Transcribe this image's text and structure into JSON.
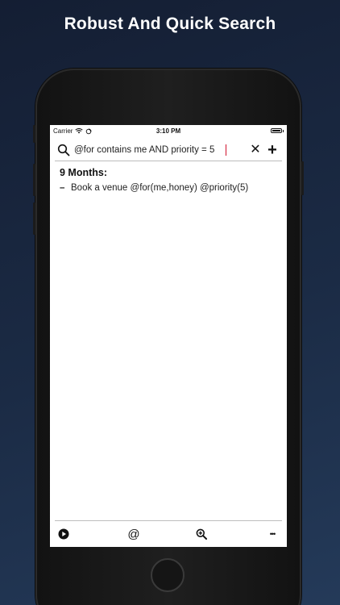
{
  "promo": {
    "headline": "Robust And Quick Search"
  },
  "status_bar": {
    "carrier": "Carrier",
    "time": "3:10 PM",
    "icons": [
      "wifi-icon",
      "activity-icon",
      "battery-icon"
    ]
  },
  "search": {
    "query": "@for contains me AND priority = 5",
    "icon": "search-icon",
    "clear_label": "✕",
    "add_label": "+"
  },
  "results": {
    "sections": [
      {
        "title": "9 Months:",
        "items": [
          {
            "bullet": "–",
            "text": "Book a venue @for(me,honey) @priority(5)"
          }
        ]
      }
    ]
  },
  "toolbar": {
    "items": [
      "play-icon",
      "at-icon",
      "zoom-icon",
      "more-icon"
    ],
    "at_label": "@",
    "more_label": "•••"
  },
  "colors": {
    "background_top": "#141e33",
    "background_bottom": "#243a59",
    "cursor": "#d0112b"
  }
}
